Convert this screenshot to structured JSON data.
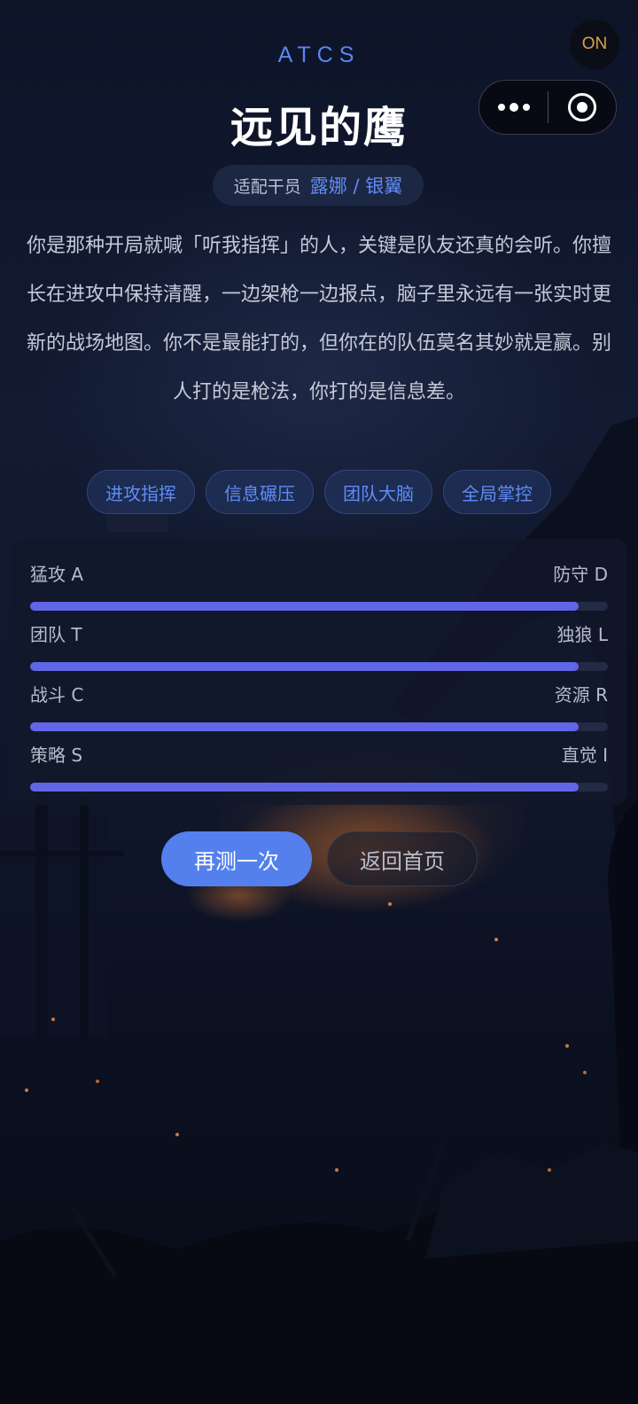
{
  "header": {
    "brand": "ATCS",
    "title": "远见的鹰",
    "on_badge": "ON"
  },
  "operator": {
    "label": "适配干员",
    "value": "露娜 / 银翼"
  },
  "description": "你是那种开局就喊「听我指挥」的人，关键是队友还真的会听。你擅长在进攻中保持清醒，一边架枪一边报点，脑子里永远有一张实时更新的战场地图。你不是最能打的，但你在的队伍莫名其妙就是赢。别人打的是枪法，你打的是信息差。",
  "tags": [
    "进攻指挥",
    "信息碾压",
    "团队大脑",
    "全局掌控"
  ],
  "stats": [
    {
      "left": "猛攻 A",
      "right": "防守 D",
      "value": 0.95
    },
    {
      "left": "团队 T",
      "right": "独狼 L",
      "value": 0.95
    },
    {
      "left": "战斗 C",
      "right": "资源 R",
      "value": 0.95
    },
    {
      "left": "策略 S",
      "right": "直觉 I",
      "value": 0.95
    }
  ],
  "buttons": {
    "retry": "再测一次",
    "home": "返回首页"
  },
  "colors": {
    "accent": "#5b86f0",
    "bar": "#6166e6",
    "on_badge": "#d9a24a"
  },
  "icons": {
    "more": "more-dots-icon",
    "close": "close-ring-icon"
  }
}
